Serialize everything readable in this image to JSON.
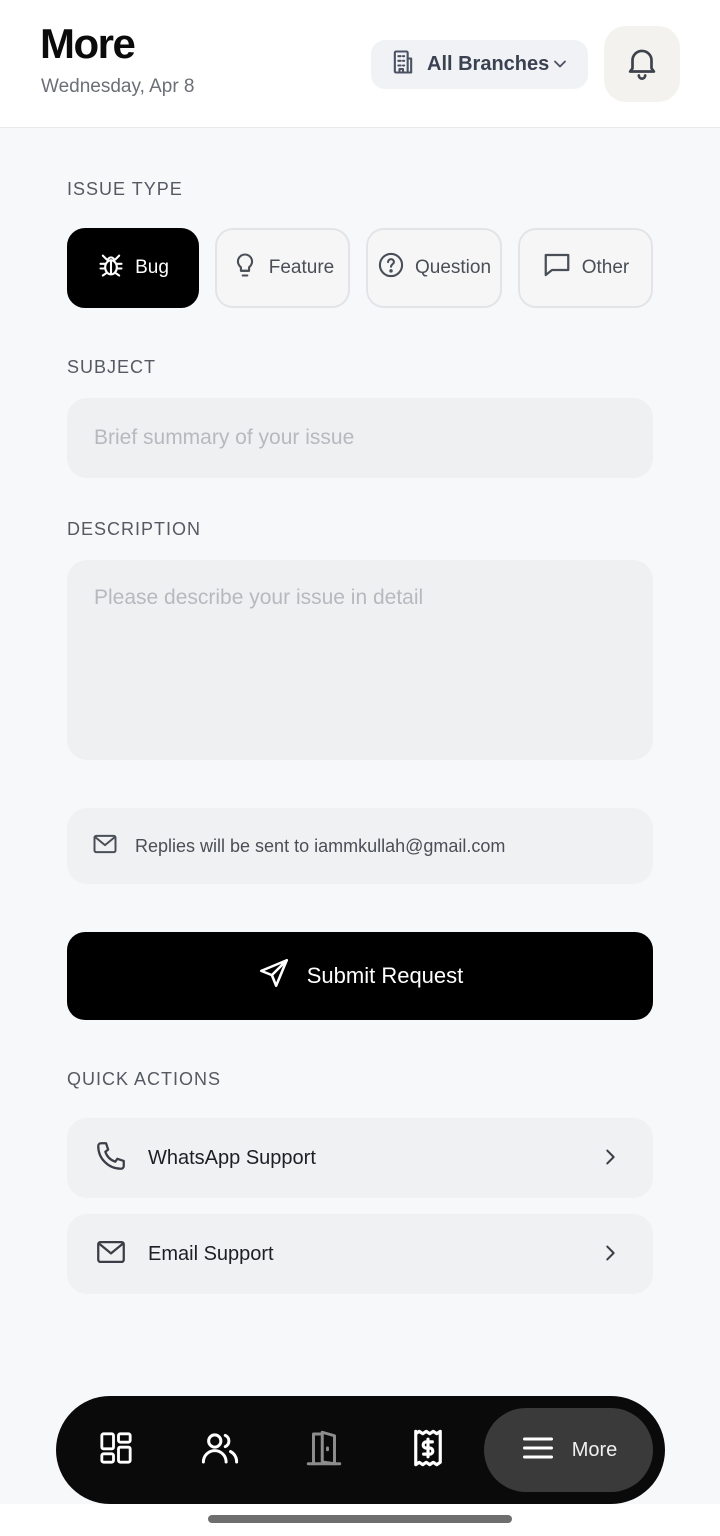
{
  "header": {
    "title": "More",
    "date": "Wednesday, Apr 8",
    "branch_label": "All Branches"
  },
  "issue_type": {
    "label": "ISSUE TYPE",
    "selected": "Bug",
    "options": [
      {
        "label": "Bug",
        "icon": "bug-icon"
      },
      {
        "label": "Feature",
        "icon": "lightbulb-icon"
      },
      {
        "label": "Question",
        "icon": "question-icon"
      },
      {
        "label": "Other",
        "icon": "chat-icon"
      }
    ]
  },
  "subject": {
    "label": "SUBJECT",
    "placeholder": "Brief summary of your issue",
    "value": ""
  },
  "description": {
    "label": "DESCRIPTION",
    "placeholder": "Please describe your issue in detail",
    "value": ""
  },
  "notice": {
    "text": "Replies will be sent to iammkullah@gmail.com"
  },
  "submit_label": "Submit Request",
  "quick_actions": {
    "label": "QUICK ACTIONS",
    "items": [
      {
        "label": "WhatsApp Support",
        "icon": "phone-icon"
      },
      {
        "label": "Email Support",
        "icon": "mail-icon"
      }
    ]
  },
  "nav": {
    "items": [
      {
        "icon": "dashboard-icon"
      },
      {
        "icon": "users-icon"
      },
      {
        "icon": "door-icon"
      },
      {
        "icon": "receipt-icon"
      }
    ],
    "active_label": "More"
  },
  "colors": {
    "accent": "#000000",
    "background": "#f7f8fa",
    "chip_border": "#e3e4e7"
  }
}
